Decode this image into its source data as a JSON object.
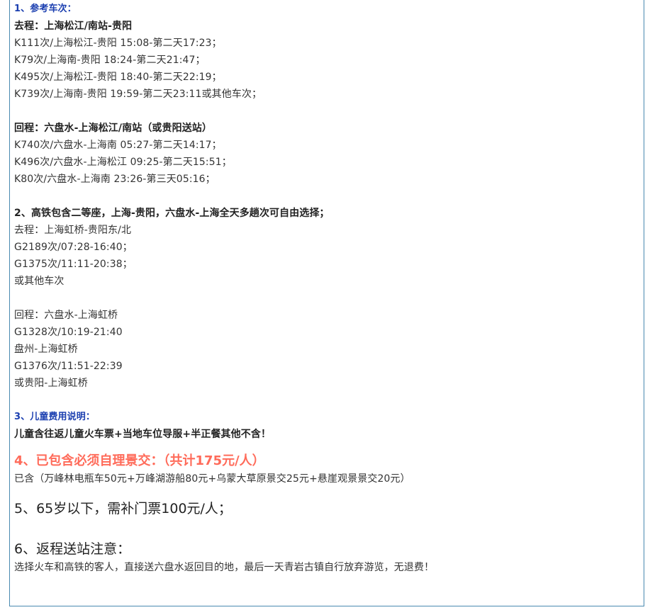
{
  "section1": {
    "heading": "1、参考车次：",
    "outbound_title": "去程：上海松江/南站-贵阳",
    "outbound_trains": [
      "K111次/上海松江-贵阳 15:08-第二天17:23；",
      "K79次/上海南-贵阳 18:24-第二天21:47；",
      "K495次/上海松江-贵阳 18:40-第二天22:19；",
      "K739次/上海南-贵阳 19:59-第二天23:11或其他车次；"
    ],
    "return_title": "回程：六盘水-上海松江/南站（或贵阳送站）",
    "return_trains": [
      "K740次/六盘水-上海南 05:27-第二天14:17；",
      "K496次/六盘水-上海松江 09:25-第二天15:51；",
      "K80次/六盘水-上海南 23:26-第三天05:16；"
    ]
  },
  "section2": {
    "heading": "2、高铁包含二等座，上海-贵阳，六盘水-上海全天多趟次可自由选择；",
    "outbound_lines": [
      "去程：上海虹桥-贵阳东/北",
      "G2189次/07:28-16:40；",
      "G1375次/11:11-20:38；",
      "或其他车次"
    ],
    "return_lines": [
      "回程：六盘水-上海虹桥",
      "G1328次/10:19-21:40",
      "盘州-上海虹桥",
      "G1376次/11:51-22:39",
      "或贵阳-上海虹桥"
    ]
  },
  "section3": {
    "heading": "3、儿童费用说明：",
    "text": "儿童含往返儿童火车票+当地车位导服+半正餐其他不含！"
  },
  "section4": {
    "heading": "4、已包含必须自理景交：（共计175元/人）",
    "text": "已含（万峰林电瓶车50元+万峰湖游船80元+乌蒙大草原景交25元+悬崖观景景交20元）"
  },
  "section5": {
    "heading": "5、65岁以下，需补门票100元/人；"
  },
  "section6": {
    "heading": "6、返程送站注意：",
    "text": "选择火车和高铁的客人，直接送六盘水返回目的地，最后一天青岩古镇自行放弃游览，无退费！"
  }
}
